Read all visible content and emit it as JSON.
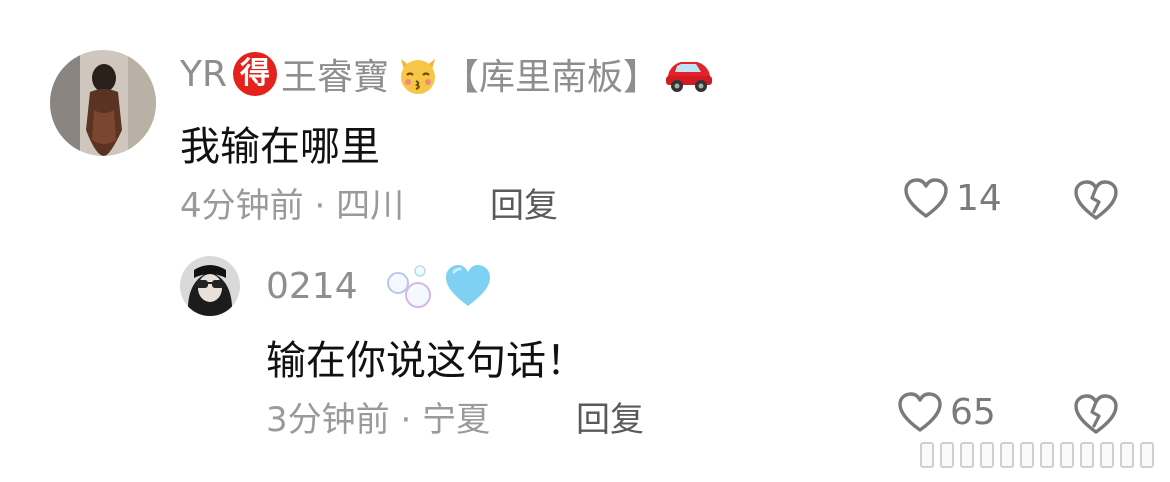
{
  "comment": {
    "username_prefix": "YR",
    "badge_text": "得",
    "username_name": "王睿寶",
    "tag": "【库里南板】",
    "text": "我输在哪里",
    "time": "4分钟前",
    "location": "四川",
    "meta_separator": " · ",
    "reply_label": "回复",
    "like_count": "14"
  },
  "reply": {
    "username": "0214",
    "text": "输在你说这句话！",
    "time": "3分钟前",
    "location": "宁夏",
    "meta_separator": " · ",
    "reply_label": "回复",
    "like_count": "65"
  },
  "icons": {
    "heart": "heart-outline-icon",
    "broken_heart": "broken-heart-icon",
    "cat": "kissing-cat-emoji",
    "car": "red-car-emoji",
    "bubbles": "bubbles-emoji",
    "blue_heart": "light-blue-heart-emoji"
  },
  "colors": {
    "badge": "#e5211c",
    "name_gray": "#8e8e8e",
    "meta_gray": "#9a9a9a",
    "blue_heart": "#7fd1f4"
  }
}
